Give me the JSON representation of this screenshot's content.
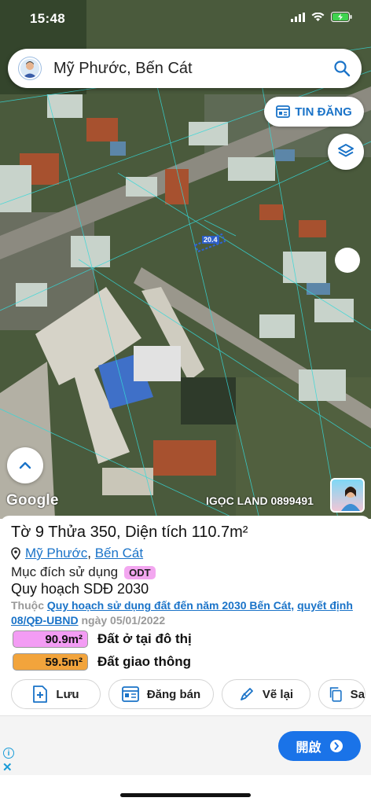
{
  "status": {
    "time": "15:48"
  },
  "search": {
    "text": "Mỹ Phước, Bến Cát"
  },
  "map": {
    "tin_dang_label": "TIN ĐĂNG",
    "google_label": "Google",
    "watermark": "IGỌC LAND 0899491",
    "parcel_label": "20.4"
  },
  "parcel": {
    "title": "Tờ 9 Thửa 350, Diện tích 110.7m²",
    "ward": "Mỹ Phước",
    "district": "Bến Cát",
    "separator": ",",
    "purpose_label": "Mục đích sử dụng",
    "purpose_code": "ODT",
    "plan_label": "Quy hoạch SDĐ 2030",
    "thuoc_prefix": "Thuộc",
    "plan_link": "Quy hoạch sử dụng đất đến năm 2030 Bến Cát,",
    "decision_link": "quyết định 08/QĐ-UBND",
    "decision_date": "ngày 05/01/2022",
    "areas": [
      {
        "value": "90.9m²",
        "label": "Đất ở tại đô thị",
        "color": "#f39cf4"
      },
      {
        "value": "59.5m²",
        "label": "Đất giao thông",
        "color": "#f2a43c"
      }
    ]
  },
  "actions": [
    {
      "label": "Lưu",
      "icon": "save-plus-icon"
    },
    {
      "label": "Đăng bán",
      "icon": "listing-icon"
    },
    {
      "label": "Vẽ lại",
      "icon": "redraw-icon"
    },
    {
      "label": "Sa",
      "icon": "copy-icon"
    }
  ],
  "ad": {
    "button_label": "開啟"
  },
  "colors": {
    "accent": "#1a73c8",
    "ad_button": "#1a73e8"
  }
}
